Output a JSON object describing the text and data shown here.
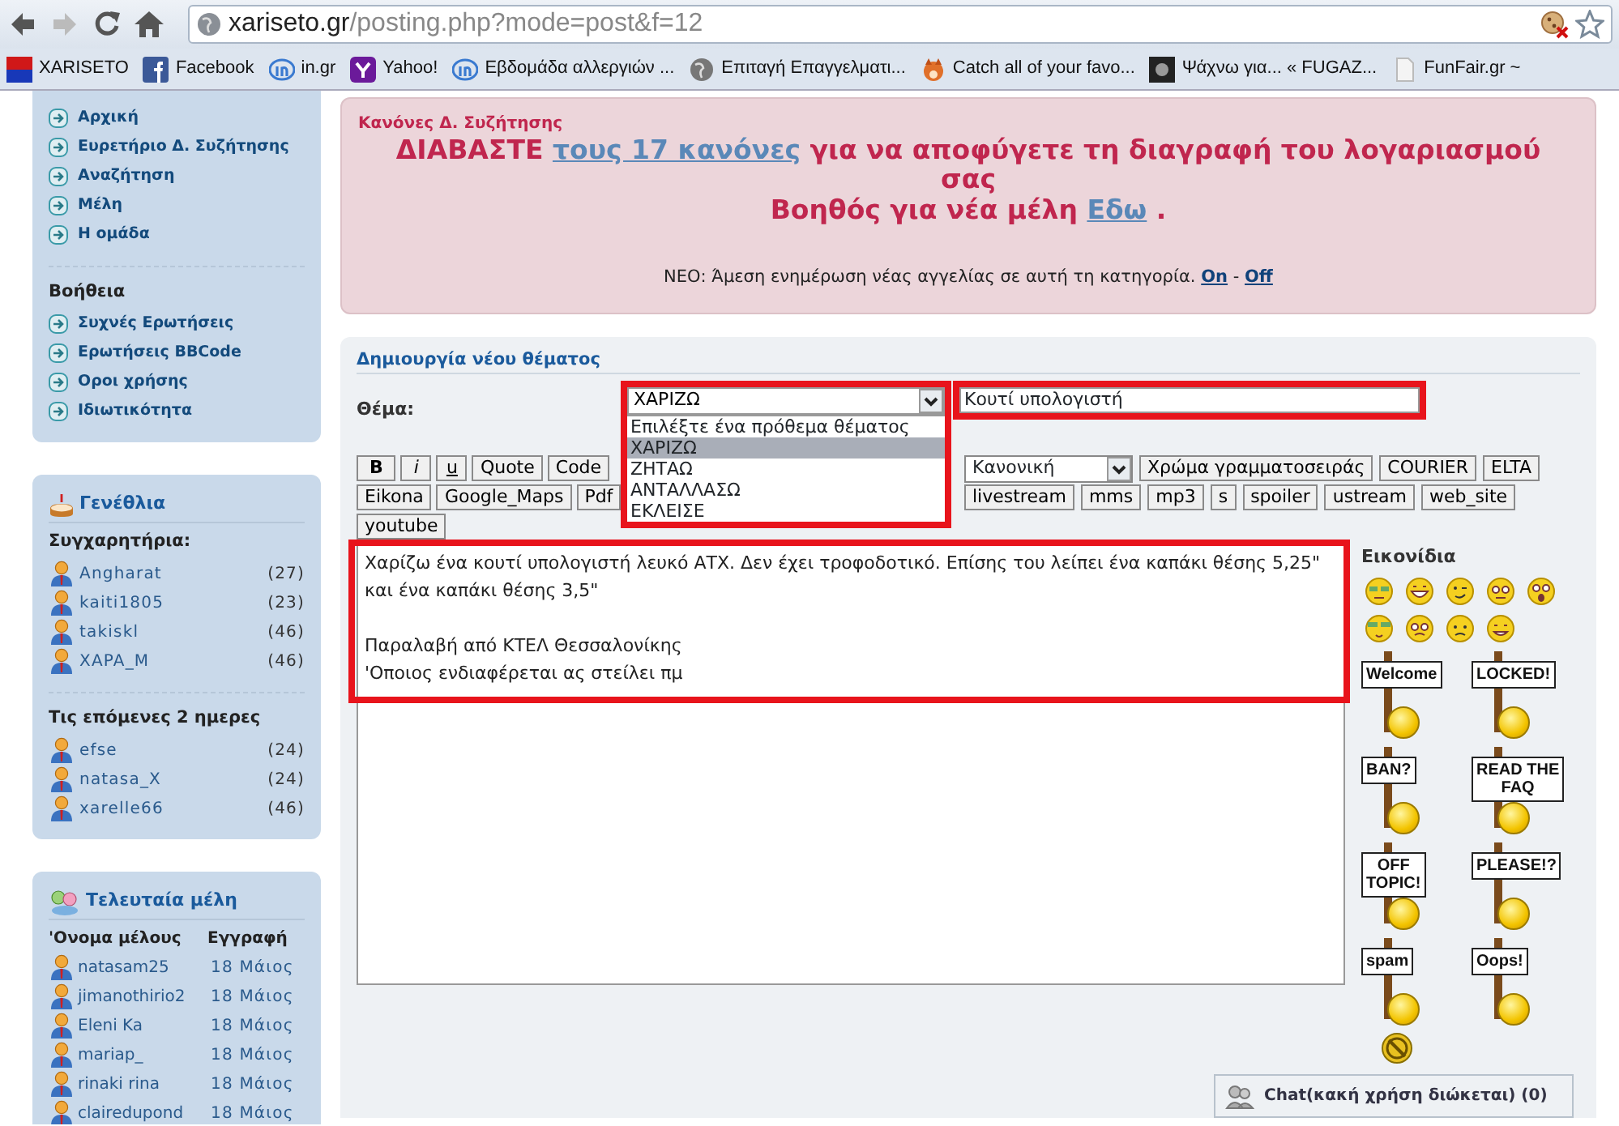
{
  "browser": {
    "url_domain": "xariseto.gr",
    "url_path": "/posting.php?mode=post&f=12",
    "bookmarks": [
      {
        "label": "XARISETO"
      },
      {
        "label": "Facebook"
      },
      {
        "label": "in.gr"
      },
      {
        "label": "Yahoo!"
      },
      {
        "label": "Εβδομάδα αλλεργιών ..."
      },
      {
        "label": "Επιταγή Επαγγελματι..."
      },
      {
        "label": "Catch all of your favo..."
      },
      {
        "label": "Ψάχνω για... « FUGAZ..."
      },
      {
        "label": "FunFair.gr ~"
      }
    ]
  },
  "nav_panel": {
    "items": [
      "Αρχική",
      "Ευρετήριο Δ. Συζήτησης",
      "Αναζήτηση",
      "Μέλη",
      "Η ομάδα"
    ],
    "help_title": "Βοήθεια",
    "help_items": [
      "Συχνές Ερωτήσεις",
      "Ερωτήσεις BBCode",
      "Οροι χρήσης",
      "Ιδιωτικότητα"
    ]
  },
  "birthdays": {
    "title": "Γενέθλια",
    "today_label": "Συγχαρητήρια:",
    "today": [
      {
        "name": "Angharat",
        "age": "(27)"
      },
      {
        "name": "kaiti1805",
        "age": "(23)"
      },
      {
        "name": "takiskl",
        "age": "(46)"
      },
      {
        "name": "XAPA_M",
        "age": "(46)"
      }
    ],
    "next_label": "Τις επόμενες 2 ημερες",
    "next": [
      {
        "name": "efse",
        "age": "(24)"
      },
      {
        "name": "natasa_X",
        "age": "(24)"
      },
      {
        "name": "xarelle66",
        "age": "(46)"
      }
    ]
  },
  "new_members": {
    "title": "Τελευταία μέλη",
    "columns": [
      "'Ονομα μέλους",
      "Εγγραφή"
    ],
    "rows": [
      {
        "name": "natasam25",
        "date": "18 Μάιος"
      },
      {
        "name": "jimanothirio2",
        "date": "18 Μάιος"
      },
      {
        "name": "Eleni Ka",
        "date": "18 Μάιος"
      },
      {
        "name": "mariap_",
        "date": "18 Μάιος"
      },
      {
        "name": "rinaki rina",
        "date": "18 Μάιος"
      },
      {
        "name": "clairedupond",
        "date": "18 Μάιος"
      }
    ]
  },
  "notice": {
    "title": "Κανόνες Δ. Συζήτησης",
    "headline_before": "ΔΙΑΒΑΣΤΕ",
    "headline_link": "τους 17 κανόνες",
    "headline_after": "για να αποφύγετε τη διαγραφή του λογαριασμού σας",
    "helper_text": "Βοηθός για νέα μέλη",
    "helper_link": "Εδω",
    "helper_end": ".",
    "news_text": "ΝΕΟ: Άμεση ενημέρωση νέας αγγελίας σε αυτή τη κατηγορία.",
    "news_on": "On",
    "news_sep": "-",
    "news_off": "Off"
  },
  "post": {
    "title": "Δημιουργία νέου θέματος",
    "subject_label": "Θέμα:",
    "prefix_value": "ΧΑΡΙΖΩ",
    "prefix_options": [
      {
        "label": "Επιλέξτε ένα πρόθεμα θέματος",
        "selected": false
      },
      {
        "label": "ΧΑΡΙΖΩ",
        "selected": true
      },
      {
        "label": "ΖΗΤΑΩ",
        "selected": false
      },
      {
        "label": "ΑΝΤΑΛΛΑΣΩ",
        "selected": false
      },
      {
        "label": "ΕΚΛΕΙΣΕ",
        "selected": false
      }
    ],
    "subject_value": "Κουτί υπολογιστή",
    "toolbar_rows": [
      {
        "left": [
          {
            "label": "B"
          },
          {
            "label": "i"
          },
          {
            "label": "u"
          },
          {
            "label": "Quote"
          },
          {
            "label": "Code"
          }
        ],
        "right": [
          {
            "label": "Κανονική",
            "kind": "select"
          },
          {
            "label": "Χρώμα γραμματοσειράς"
          },
          {
            "label": "COURIER"
          },
          {
            "label": "ELTA"
          }
        ]
      },
      {
        "left": [
          {
            "label": "Eikona"
          },
          {
            "label": "Google_Maps"
          },
          {
            "label": "Pdf"
          }
        ],
        "right": [
          {
            "label": "livestream"
          },
          {
            "label": "mms"
          },
          {
            "label": "mp3"
          },
          {
            "label": "s"
          },
          {
            "label": "spoiler"
          },
          {
            "label": "ustream"
          },
          {
            "label": "web_site"
          }
        ]
      },
      {
        "left": [
          {
            "label": "youtube"
          }
        ],
        "right": []
      }
    ],
    "message": "Χαρίζω ένα κουτί υπολογιστή λευκό ΑΤΧ. Δεν έχει τροφοδοτικό. Επίσης του λείπει ένα καπάκι θέσης 5,25\" και ένα καπάκι θέσης 3,5\"\n\nΠαραλαβή από ΚΤΕΛ Θεσσαλονίκης\n'Οποιος ενδιαφέρεται ας στείλει πμ",
    "smilies_title": "Εικονίδια",
    "signs": [
      {
        "lines": [
          "Welcome"
        ]
      },
      {
        "lines": [
          "LOCKED!"
        ]
      },
      {
        "lines": [
          "BAN?"
        ]
      },
      {
        "lines": [
          "READ THE",
          "FAQ"
        ]
      },
      {
        "lines": [
          "OFF",
          "TOPIC!"
        ]
      },
      {
        "lines": [
          "PLEASE!?"
        ]
      },
      {
        "lines": [
          "spam"
        ]
      },
      {
        "lines": [
          "Oops!"
        ]
      }
    ]
  },
  "chat": {
    "label": "Chat(κακή χρήση διώκεται) (0)"
  }
}
